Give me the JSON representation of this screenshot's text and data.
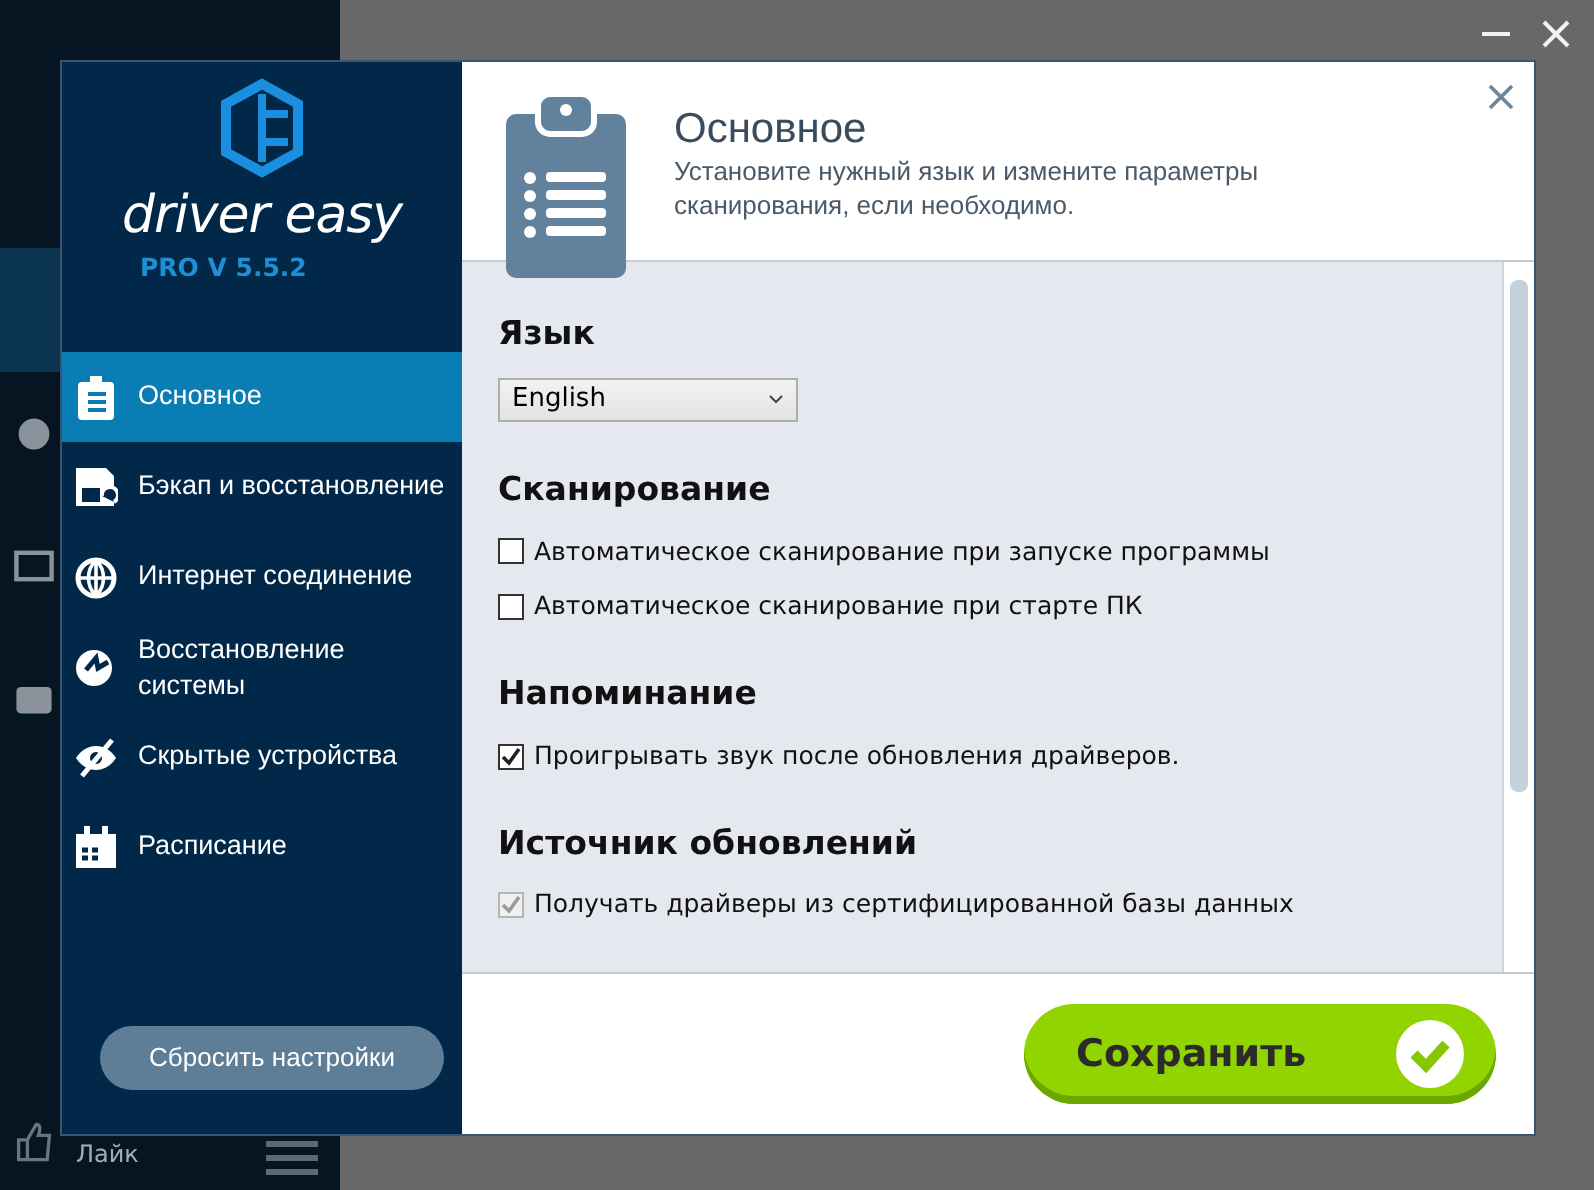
{
  "background_app": {
    "like_label": "Лайк"
  },
  "sidebar": {
    "logo_text": "driver easy",
    "version": "PRO V 5.5.2",
    "items": [
      {
        "label": "Основное",
        "selected": true
      },
      {
        "label": "Бэкап и восстановление",
        "selected": false
      },
      {
        "label": "Интернет соединение",
        "selected": false
      },
      {
        "label": "Восстановление системы",
        "selected": false
      },
      {
        "label": "Скрытые устройства",
        "selected": false
      },
      {
        "label": "Расписание",
        "selected": false
      }
    ],
    "reset_button": "Сбросить настройки"
  },
  "header": {
    "title": "Основное",
    "description": "Установите нужный язык и измените параметры сканирования, если необходимо."
  },
  "sections": [
    {
      "title": "Язык",
      "kind": "select",
      "value": "English"
    },
    {
      "title": "Сканирование",
      "kind": "checkboxes",
      "options": [
        {
          "label": "Автоматическое сканирование при запуске программы",
          "checked": false,
          "disabled": false
        },
        {
          "label": "Автоматическое сканирование при старте ПК",
          "checked": false,
          "disabled": false
        }
      ]
    },
    {
      "title": "Напоминание",
      "kind": "checkboxes",
      "options": [
        {
          "label": "Проигрывать звук после обновления драйверов.",
          "checked": true,
          "disabled": false
        }
      ]
    },
    {
      "title": "Источник обновлений",
      "kind": "checkboxes",
      "options": [
        {
          "label": "Получать драйверы из сертифицированной базы данных",
          "checked": true,
          "disabled": true
        }
      ]
    }
  ],
  "save_button": "Сохранить"
}
